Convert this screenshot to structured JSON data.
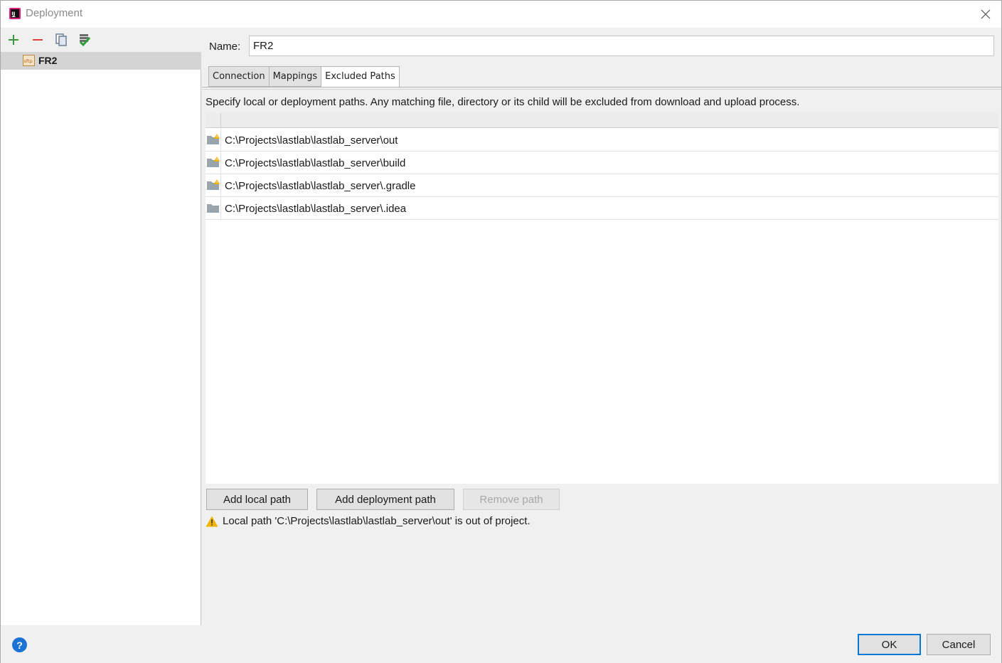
{
  "window": {
    "title": "Deployment"
  },
  "sidebar": {
    "toolbar": {
      "add_icon": "plus-icon",
      "remove_icon": "minus-icon",
      "copy_icon": "copy-icon",
      "default_icon": "check-server-icon"
    },
    "servers": [
      {
        "label": "FR2",
        "icon": "sftp-icon",
        "selected": true
      }
    ]
  },
  "form": {
    "name_label": "Name:",
    "name_value": "FR2"
  },
  "tabs": [
    {
      "label": "Connection",
      "active": false
    },
    {
      "label": "Mappings",
      "active": false
    },
    {
      "label": "Excluded Paths",
      "active": true
    }
  ],
  "excluded": {
    "description": "Specify local or deployment paths. Any matching file, directory or its child will be excluded from download and upload process.",
    "rows": [
      {
        "path": "C:\\Projects\\lastlab\\lastlab_server\\out",
        "icon": "folder-warning-icon"
      },
      {
        "path": "C:\\Projects\\lastlab\\lastlab_server\\build",
        "icon": "folder-warning-icon"
      },
      {
        "path": "C:\\Projects\\lastlab\\lastlab_server\\.gradle",
        "icon": "folder-warning-icon"
      },
      {
        "path": "C:\\Projects\\lastlab\\lastlab_server\\.idea",
        "icon": "folder-icon"
      }
    ],
    "buttons": {
      "add_local": "Add local path",
      "add_deployment": "Add deployment path",
      "remove": "Remove path"
    },
    "warning": "Local path 'C:\\Projects\\lastlab\\lastlab_server\\out' is out of project."
  },
  "dialog": {
    "help": "?",
    "ok": "OK",
    "cancel": "Cancel"
  },
  "colors": {
    "accent": "#0078d7",
    "add_green": "#3a9a3a",
    "remove_red": "#d9413d",
    "warning": "#e8a800"
  }
}
